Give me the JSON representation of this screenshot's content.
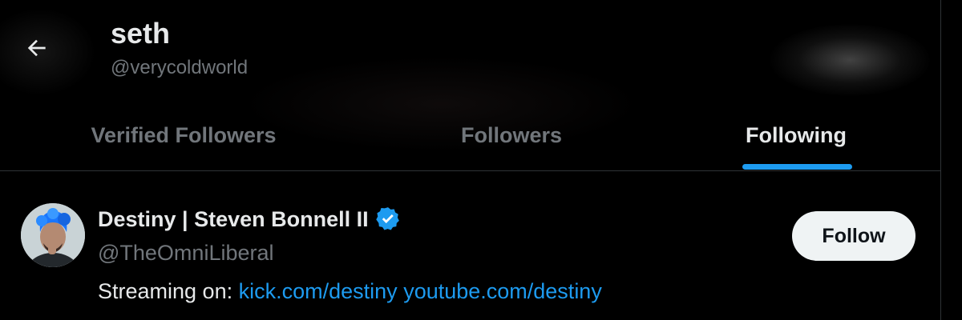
{
  "header": {
    "back_icon": "arrow-left-icon",
    "name": "seth",
    "handle": "@verycoldworld"
  },
  "tabs": [
    {
      "label": "Verified Followers",
      "active": false
    },
    {
      "label": "Followers",
      "active": false
    },
    {
      "label": "Following",
      "active": true
    }
  ],
  "users": [
    {
      "avatar_icon": "avatar",
      "display_name": "Destiny | Steven Bonnell II",
      "verified_icon": "verified-badge-icon",
      "handle": "@TheOmniLiberal",
      "bio_prefix": "Streaming on:",
      "bio_links": [
        "kick.com/destiny",
        "youtube.com/destiny"
      ],
      "follow_label": "Follow"
    }
  ],
  "colors": {
    "background": "#000000",
    "accent": "#1d9bf0",
    "text_primary": "#e7e9ea",
    "text_secondary": "#71767b",
    "border": "#2f3336",
    "follow_button_bg": "#eff3f4"
  }
}
